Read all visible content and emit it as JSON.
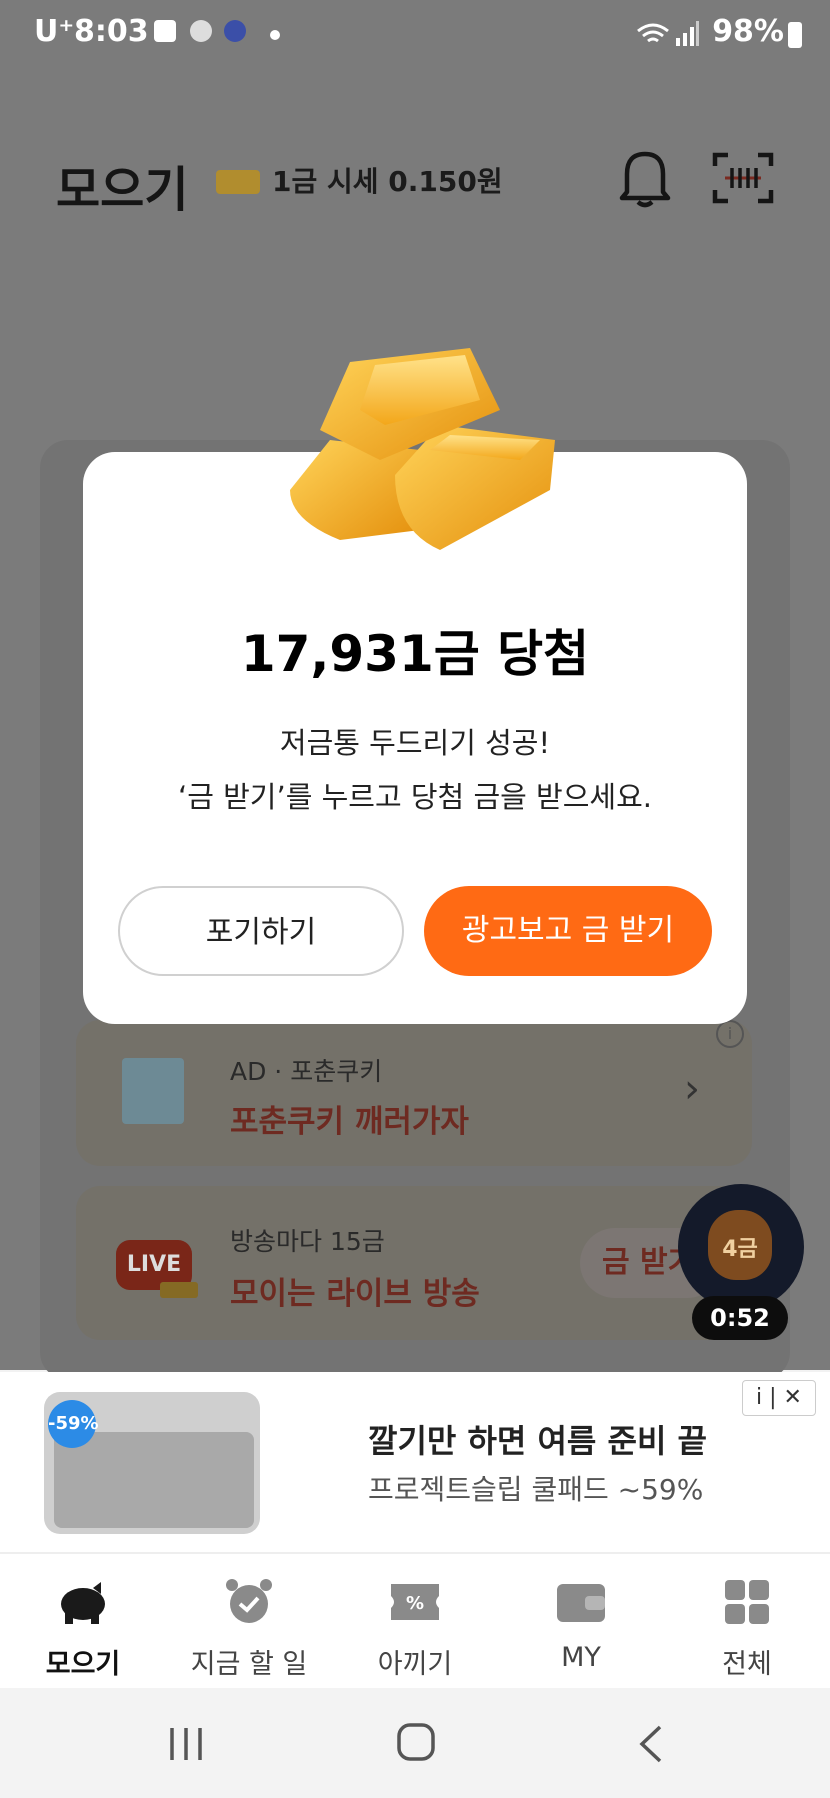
{
  "status_bar": {
    "carrier": "U⁺",
    "time": "8:03",
    "battery": "98%"
  },
  "header": {
    "title": "모으기",
    "gold_rate": "1금 시세 0.150원"
  },
  "dialog": {
    "title": "17,931금 당첨",
    "line1": "저금통 두드리기 성공!",
    "line2": "‘금 받기’를 누르고 당첨 금을 받으세요.",
    "cancel_label": "포기하기",
    "confirm_label": "광고보고 금 받기",
    "accent_color": "#ff6a14"
  },
  "cards": {
    "ad": {
      "sub": "AD · 포춘쿠키",
      "title": "포춘쿠키 깨러가자"
    },
    "live": {
      "sub": "방송마다 15금",
      "title": "모이는 라이브 방송",
      "badge": "LIVE",
      "button": "금 받기"
    }
  },
  "floating": {
    "bag_label": "4금",
    "timer": "0:52"
  },
  "banner_ad": {
    "discount": "-59%",
    "title": "깔기만 하면 여름 준비 끝",
    "subtitle": "프로젝트슬립 쿨패드 ~59%",
    "info": "i | ✕"
  },
  "bottom_nav": {
    "items": [
      {
        "label": "모으기",
        "icon": "piggy-bank-icon",
        "active": true
      },
      {
        "label": "지금 할 일",
        "icon": "alarm-clock-icon",
        "active": false
      },
      {
        "label": "아끼기",
        "icon": "coupon-icon",
        "active": false
      },
      {
        "label": "MY",
        "icon": "wallet-icon",
        "active": false
      },
      {
        "label": "전체",
        "icon": "grid-icon",
        "active": false
      }
    ]
  }
}
